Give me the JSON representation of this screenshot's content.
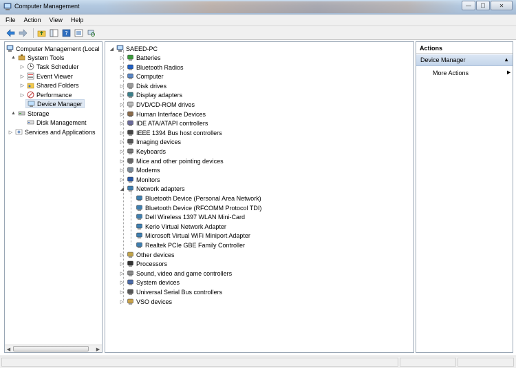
{
  "window": {
    "title": "Computer Management",
    "minimize_glyph": "—",
    "maximize_glyph": "☐",
    "close_glyph": "✕"
  },
  "menu": [
    "File",
    "Action",
    "View",
    "Help"
  ],
  "toolbar": [
    "back-icon",
    "forward-icon",
    "up-folder-icon",
    "console-tree-icon",
    "help-icon",
    "properties-icon",
    "scan-hardware-icon"
  ],
  "left_tree": {
    "items": [
      {
        "label": "Computer Management (Local",
        "expander": "",
        "icon": "computer-icon"
      },
      {
        "label": "System Tools",
        "expander": "▲",
        "icon": "tools-icon"
      },
      {
        "label": "Task Scheduler",
        "expander": "▷",
        "icon": "clock-icon"
      },
      {
        "label": "Event Viewer",
        "expander": "▷",
        "icon": "event-viewer-icon"
      },
      {
        "label": "Shared Folders",
        "expander": "▷",
        "icon": "shared-folder-icon"
      },
      {
        "label": "Performance",
        "expander": "▷",
        "icon": "performance-icon"
      },
      {
        "label": "Device Manager",
        "expander": "",
        "icon": "device-manager-icon"
      },
      {
        "label": "Storage",
        "expander": "▲",
        "icon": "storage-icon"
      },
      {
        "label": "Disk Management",
        "expander": "",
        "icon": "disk-management-icon"
      },
      {
        "label": "Services and Applications",
        "expander": "▷",
        "icon": "services-icon"
      }
    ]
  },
  "device_tree": {
    "root": "SAEED-PC",
    "categories": [
      {
        "label": "Batteries",
        "icon": "battery-icon"
      },
      {
        "label": "Bluetooth Radios",
        "icon": "bluetooth-icon"
      },
      {
        "label": "Computer",
        "icon": "computer-icon"
      },
      {
        "label": "Disk drives",
        "icon": "disk-drive-icon"
      },
      {
        "label": "Display adapters",
        "icon": "display-adapter-icon"
      },
      {
        "label": "DVD/CD-ROM drives",
        "icon": "dvd-icon"
      },
      {
        "label": "Human Interface Devices",
        "icon": "hid-icon"
      },
      {
        "label": "IDE ATA/ATAPI controllers",
        "icon": "ide-icon"
      },
      {
        "label": "IEEE 1394 Bus host controllers",
        "icon": "ieee1394-icon"
      },
      {
        "label": "Imaging devices",
        "icon": "camera-icon"
      },
      {
        "label": "Keyboards",
        "icon": "keyboard-icon"
      },
      {
        "label": "Mice and other pointing devices",
        "icon": "mouse-icon"
      },
      {
        "label": "Modems",
        "icon": "modem-icon"
      },
      {
        "label": "Monitors",
        "icon": "monitor-icon"
      },
      {
        "label": "Network adapters",
        "icon": "network-adapter-icon"
      }
    ],
    "network_children": [
      "Bluetooth Device (Personal Area Network)",
      "Bluetooth Device (RFCOMM Protocol TDI)",
      "Dell Wireless 1397 WLAN Mini-Card",
      "Kerio Virtual Network Adapter",
      "Microsoft Virtual WiFi Miniport Adapter",
      "Realtek PCIe GBE Family Controller"
    ],
    "categories_after": [
      {
        "label": "Other devices",
        "icon": "other-devices-icon"
      },
      {
        "label": "Processors",
        "icon": "processor-icon"
      },
      {
        "label": "Sound, video and game controllers",
        "icon": "sound-icon"
      },
      {
        "label": "System devices",
        "icon": "system-devices-icon"
      },
      {
        "label": "Universal Serial Bus controllers",
        "icon": "usb-icon"
      },
      {
        "label": "VSO devices",
        "icon": "vso-icon"
      }
    ]
  },
  "actions": {
    "header": "Actions",
    "section": "Device Manager",
    "more": "More Actions"
  }
}
